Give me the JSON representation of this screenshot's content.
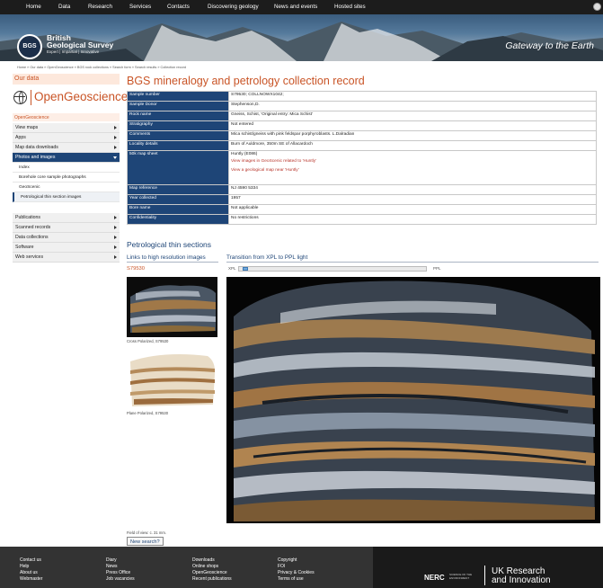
{
  "nav": {
    "items": [
      "Home",
      "Data",
      "Research",
      "Services",
      "Contacts",
      "Discovering geology",
      "News and events",
      "Hosted sites"
    ]
  },
  "banner": {
    "logo_text": "BGS",
    "org_line1": "British",
    "org_line2": "Geological Survey",
    "tagline": "Expert | Impartial | Innovative",
    "slogan": "Gateway to the Earth"
  },
  "breadcrumb": "Home » Our data » OpenGeoscience » BGS rock collections » Search form » Search results » Collection record",
  "sidebar": {
    "title": "Our data",
    "logo_text": "OpenGeoscience",
    "section": "OpenGeoscience",
    "menu1": [
      "View maps",
      "Apps",
      "Map data downloads"
    ],
    "active": "Photos and images",
    "subitems": [
      "Index",
      "Borehole core sample photographs",
      "GeoScenic",
      "Petrological thin section images"
    ],
    "menu2": [
      "Publications",
      "Scanned records",
      "Data collections",
      "Software",
      "Web services"
    ]
  },
  "page": {
    "title": "BGS mineralogy and petrology collection record"
  },
  "record": {
    "sample_number": {
      "label": "Sample number",
      "value": "S79530; COLLNOWX1042;"
    },
    "sample_donor": {
      "label": "Sample Donor",
      "value": "Stephenson,D."
    },
    "rock_name": {
      "label": "Rock name",
      "value": "Gneiss, Schist, 'Original entry: Mica Schist'"
    },
    "stratigraphy": {
      "label": "Stratigraphy",
      "value": "Not entered"
    },
    "comments": {
      "label": "Comments",
      "value": "Mica schist/gneiss with pink feldspar porphyroblasts. L.Dalradian"
    },
    "locality": {
      "label": "Locality details",
      "value": "Burn of Auldmore, 350m SE of Allacardoch"
    },
    "map_sheet": {
      "label": "50k map sheet",
      "value": "Huntly (E086)",
      "link1": "View images in GeoScenic related to 'Huntly'",
      "link2": "View a geological map near 'Huntly'"
    },
    "map_ref": {
      "label": "Map reference",
      "value": "NJ 4590 5334"
    },
    "year": {
      "label": "Year collected",
      "value": "1957"
    },
    "bore": {
      "label": "Bore name",
      "value": "Not applicable"
    },
    "confidentiality": {
      "label": "Confidentiality",
      "value": "No restrictions"
    }
  },
  "thin": {
    "title": "Petrological thin sections",
    "links_header": "Links to high resolution images",
    "transition_header": "Transition from XPL to PPL light",
    "sample_id": "S79530",
    "xpl": "XPL",
    "ppl": "PPL",
    "slider_value": 0.02,
    "cap1": "Cross Polarized, S79530",
    "cap2": "Plane Polarized, S79530",
    "fov": "Field of view: c. 31 mm.",
    "new_search": "New search?"
  },
  "footer": {
    "col1": [
      "Contact us",
      "Help",
      "About us",
      "Webmaster"
    ],
    "col2": [
      "Diary",
      "News",
      "Press Office",
      "Job vacancies"
    ],
    "col3": [
      "Downloads",
      "Online shops",
      "OpenGeoscience",
      "Recent publications"
    ],
    "col4": [
      "Copyright",
      "FOI",
      "Privacy & Cookies",
      "Terms of use"
    ],
    "nerc": "NERC",
    "nerc_sub1": "SCIENCE OF THE",
    "nerc_sub2": "ENVIRONMENT",
    "ukri_line1": "UK Research",
    "ukri_line2": "and Innovation"
  },
  "colors": {
    "accent": "#c95426",
    "navy": "#1e4577",
    "dark": "#1c1c1c"
  },
  "icons": {
    "search": "search-icon",
    "logo": "globe-icon"
  }
}
